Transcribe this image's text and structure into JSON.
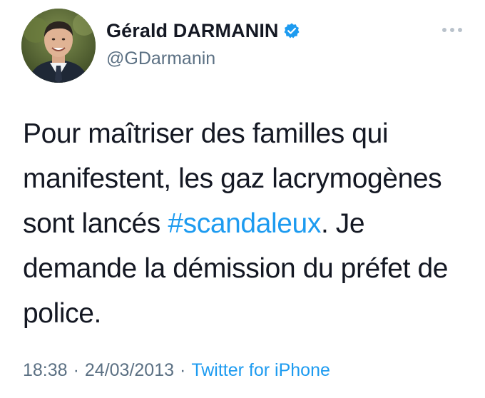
{
  "author": {
    "display_name": "Gérald DARMANIN",
    "handle": "@GDarmanin",
    "verified": true,
    "avatar_icon": "profile-photo"
  },
  "tweet": {
    "line1": "Pour maîtriser des familles qui",
    "line2": "manifestent, les gaz lacrymogènes",
    "line3_before": "sont lancés ",
    "hashtag": "#scandaleux",
    "line3_after": ". Je",
    "line4": "demande la démission du préfet de",
    "line5": "police."
  },
  "meta": {
    "time": "18:38",
    "separator": "·",
    "date": "24/03/2013",
    "source": "Twitter for iPhone"
  },
  "colors": {
    "link": "#1d9bf0",
    "verified": "#1d9bf0",
    "secondary_text": "#5b7083",
    "primary_text": "#141823"
  },
  "icons": {
    "verified": "verified-badge-icon",
    "more": "more-options-icon"
  }
}
